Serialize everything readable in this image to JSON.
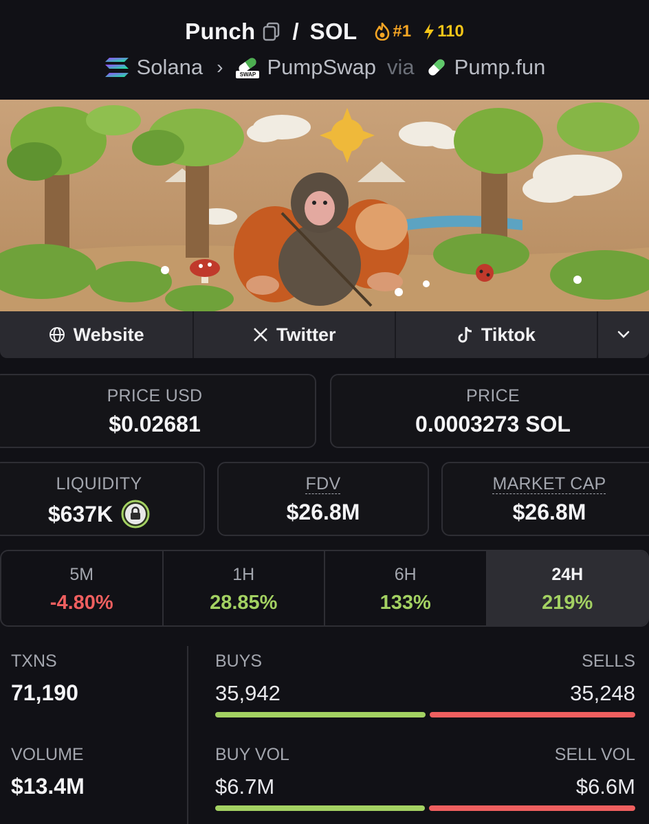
{
  "header": {
    "token_name": "Punch",
    "separator": "/",
    "quote": "SOL",
    "rank": "#1",
    "boosts": "110",
    "chain": "Solana",
    "dex": "PumpSwap",
    "dex_badge": "SWAP",
    "via": "via",
    "launchpad": "Pump.fun"
  },
  "links": {
    "website": "Website",
    "twitter": "Twitter",
    "tiktok": "Tiktok"
  },
  "prices": {
    "price_usd_label": "PRICE USD",
    "price_usd": "$0.02681",
    "price_label": "PRICE",
    "price_native": "0.0003273 SOL"
  },
  "metrics": {
    "liquidity_label": "LIQUIDITY",
    "liquidity": "$637K",
    "fdv_label": "FDV",
    "fdv": "$26.8M",
    "mcap_label": "MARKET CAP",
    "mcap": "$26.8M"
  },
  "changes": [
    {
      "label": "5M",
      "value": "-4.80%",
      "direction": "down"
    },
    {
      "label": "1H",
      "value": "28.85%",
      "direction": "up"
    },
    {
      "label": "6H",
      "value": "133%",
      "direction": "up"
    },
    {
      "label": "24H",
      "value": "219%",
      "direction": "up",
      "selected": true
    }
  ],
  "txns": {
    "txns_label": "TXNS",
    "txns": "71,190",
    "buys_label": "BUYS",
    "buys": "35,942",
    "sells_label": "SELLS",
    "sells": "35,248",
    "buy_share": 0.505,
    "volume_label": "VOLUME",
    "volume": "$13.4M",
    "buy_vol_label": "BUY VOL",
    "buy_vol": "$6.7M",
    "sell_vol_label": "SELL VOL",
    "sell_vol": "$6.6M",
    "buy_vol_share": 0.504
  },
  "colors": {
    "background": "#111116",
    "positive": "#a3d162",
    "negative": "#ef5f5f",
    "rank": "#f5a524",
    "boost": "#f5c518"
  }
}
